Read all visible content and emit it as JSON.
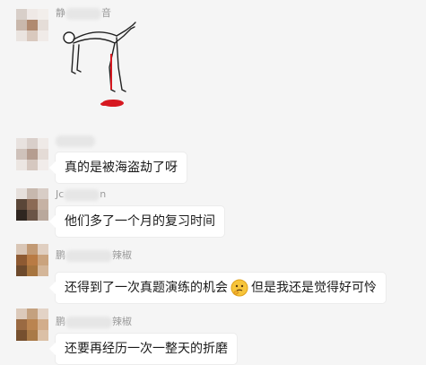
{
  "messages": [
    {
      "name_visible_left": "静",
      "name_visible_right": "音",
      "type": "sticker"
    },
    {
      "name_visible": "",
      "text": "真的是被海盗劫了呀"
    },
    {
      "name_visible_left": "Jc",
      "name_visible_right": "n",
      "text": "他们多了一个月的复习时间"
    },
    {
      "name_visible_left": "鹏",
      "name_visible_right": "辣椒",
      "text_before": "还得到了一次真题演练的机会",
      "emoji": "thinking-face-icon",
      "text_after": "但是我还是觉得好可怜"
    },
    {
      "name_visible_left": "鹏",
      "name_visible_right": "辣椒",
      "text": "还要再经历一次一整天的折磨"
    }
  ],
  "colors": {
    "background": "#f5f5f5",
    "bubble": "#ffffff",
    "blood": "#d61820"
  }
}
